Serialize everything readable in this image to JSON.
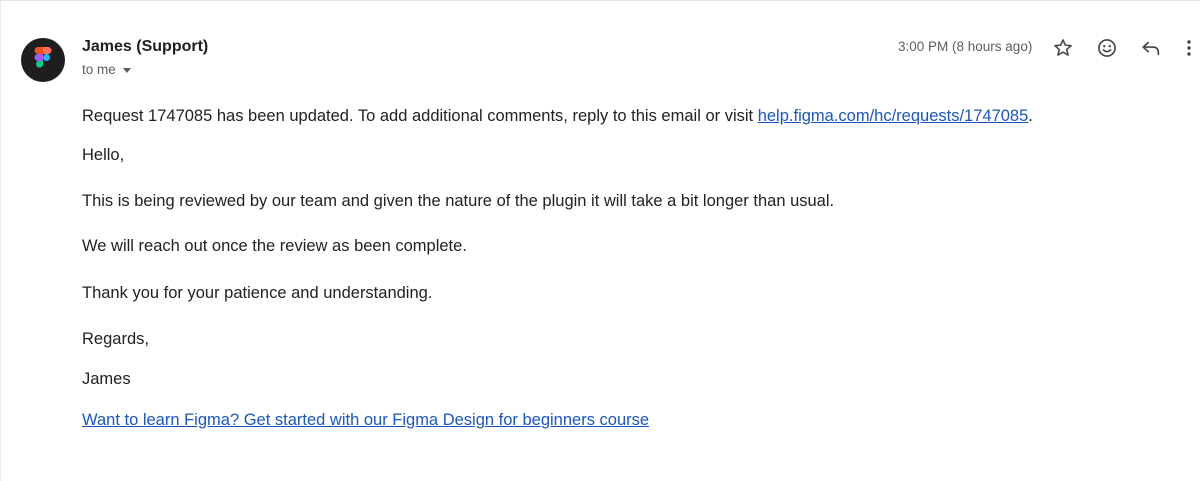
{
  "message": {
    "sender_name": "James (Support)",
    "recipient_label": "to me",
    "time": "3:00 PM (8 hours ago)",
    "icons": {
      "avatar": "figma-logo-icon",
      "star": "star-icon",
      "emoji": "emoji-reaction-icon",
      "reply": "reply-icon",
      "more": "more-vert-icon",
      "recipient_dropdown": "caret-down-icon"
    },
    "body": {
      "intro_prefix": "Request 1747085 has been updated. To add additional comments, reply to this email or visit ",
      "intro_link": "help.figma.com/hc/requests/1747085",
      "intro_suffix": ".",
      "greeting": "Hello,",
      "line1": "This is being reviewed by our team and given the nature of the plugin it will take a bit longer than usual.",
      "line2": "We will reach out once the review as been complete.",
      "line3": "Thank you for your patience and understanding.",
      "closing": "Regards,",
      "signature": "James",
      "promo_link": "Want to learn Figma? Get started with our Figma Design for beginners course"
    }
  },
  "colors": {
    "link": "#1a56c4",
    "text": "#222222",
    "muted": "#5e5e5e",
    "avatar_bg": "#1e1e1e"
  }
}
